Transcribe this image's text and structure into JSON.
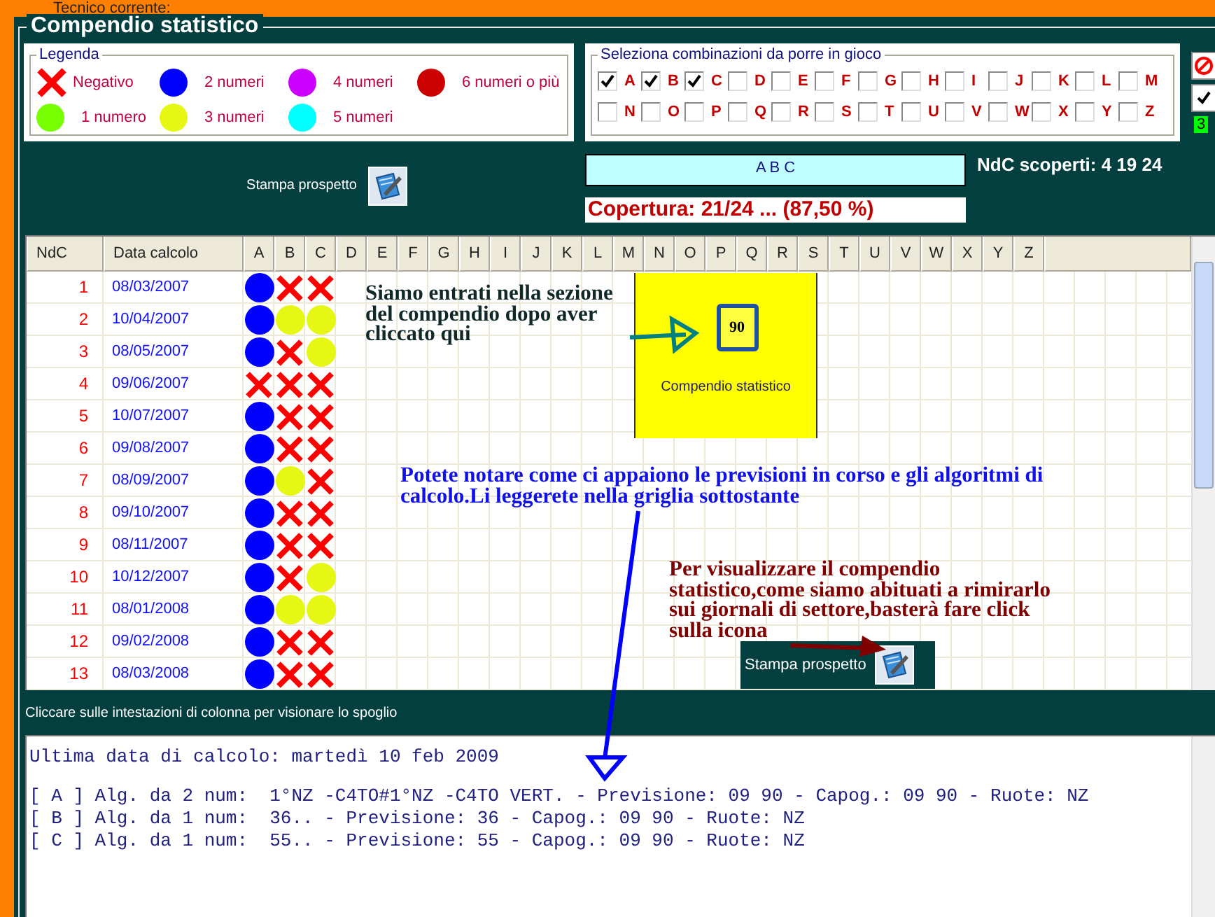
{
  "top_bar": {
    "label": "Tecnico corrente:"
  },
  "panel": {
    "title": "Compendio statistico"
  },
  "legend": {
    "title": "Legenda",
    "items": [
      {
        "kind": "cross",
        "label": "Negativo"
      },
      {
        "kind": "dot",
        "label": "2 numeri",
        "color": "#0000ff"
      },
      {
        "kind": "dot",
        "label": "4 numeri",
        "color": "#cc00ff"
      },
      {
        "kind": "dot",
        "label": "6 numeri o più",
        "color": "#cc0000"
      },
      {
        "kind": "dot",
        "label": "1 numero",
        "color": "#77ff00"
      },
      {
        "kind": "dot",
        "label": "3 numeri",
        "color": "#e6f714"
      },
      {
        "kind": "dot",
        "label": "5 numeri",
        "color": "#00ffff"
      }
    ]
  },
  "selection": {
    "title": "Seleziona combinazioni da porre in gioco",
    "count": "3",
    "options": [
      {
        "label": "A",
        "checked": true
      },
      {
        "label": "B",
        "checked": true
      },
      {
        "label": "C",
        "checked": true
      },
      {
        "label": "D",
        "checked": false
      },
      {
        "label": "E",
        "checked": false
      },
      {
        "label": "F",
        "checked": false
      },
      {
        "label": "G",
        "checked": false
      },
      {
        "label": "H",
        "checked": false
      },
      {
        "label": "I",
        "checked": false
      },
      {
        "label": "J",
        "checked": false
      },
      {
        "label": "K",
        "checked": false
      },
      {
        "label": "L",
        "checked": false
      },
      {
        "label": "M",
        "checked": false
      },
      {
        "label": "N",
        "checked": false
      },
      {
        "label": "O",
        "checked": false
      },
      {
        "label": "P",
        "checked": false
      },
      {
        "label": "Q",
        "checked": false
      },
      {
        "label": "R",
        "checked": false
      },
      {
        "label": "S",
        "checked": false
      },
      {
        "label": "T",
        "checked": false
      },
      {
        "label": "U",
        "checked": false
      },
      {
        "label": "V",
        "checked": false
      },
      {
        "label": "W",
        "checked": false
      },
      {
        "label": "X",
        "checked": false
      },
      {
        "label": "Y",
        "checked": false
      },
      {
        "label": "Z",
        "checked": false
      }
    ]
  },
  "print_button": {
    "label": "Stampa prospetto"
  },
  "selected_combinations": "A B C",
  "uncovered": "NdC scoperti: 4 19 24",
  "coverage": "Copertura: 21/24 ... (87,50 %)",
  "grid": {
    "columns": [
      "NdC",
      "Data calcolo",
      "A",
      "B",
      "C",
      "D",
      "E",
      "F",
      "G",
      "H",
      "I",
      "J",
      "K",
      "L",
      "M",
      "N",
      "O",
      "P",
      "Q",
      "R",
      "S",
      "T",
      "U",
      "V",
      "W",
      "X",
      "Y",
      "Z"
    ],
    "rows": [
      {
        "ndc": "1",
        "date": "08/03/2007",
        "results": [
          {
            "kind": "dot",
            "color": "#0000ff"
          },
          {
            "kind": "cross"
          },
          {
            "kind": "cross"
          }
        ]
      },
      {
        "ndc": "2",
        "date": "10/04/2007",
        "results": [
          {
            "kind": "dot",
            "color": "#0000ff"
          },
          {
            "kind": "dot",
            "color": "#e6f714"
          },
          {
            "kind": "dot",
            "color": "#e6f714"
          }
        ]
      },
      {
        "ndc": "3",
        "date": "08/05/2007",
        "results": [
          {
            "kind": "dot",
            "color": "#0000ff"
          },
          {
            "kind": "cross"
          },
          {
            "kind": "dot",
            "color": "#e6f714"
          }
        ]
      },
      {
        "ndc": "4",
        "date": "09/06/2007",
        "results": [
          {
            "kind": "cross"
          },
          {
            "kind": "cross"
          },
          {
            "kind": "cross"
          }
        ]
      },
      {
        "ndc": "5",
        "date": "10/07/2007",
        "results": [
          {
            "kind": "dot",
            "color": "#0000ff"
          },
          {
            "kind": "cross"
          },
          {
            "kind": "cross"
          }
        ]
      },
      {
        "ndc": "6",
        "date": "09/08/2007",
        "results": [
          {
            "kind": "dot",
            "color": "#0000ff"
          },
          {
            "kind": "cross"
          },
          {
            "kind": "cross"
          }
        ]
      },
      {
        "ndc": "7",
        "date": "08/09/2007",
        "results": [
          {
            "kind": "dot",
            "color": "#0000ff"
          },
          {
            "kind": "dot",
            "color": "#e6f714"
          },
          {
            "kind": "cross"
          }
        ]
      },
      {
        "ndc": "8",
        "date": "09/10/2007",
        "results": [
          {
            "kind": "dot",
            "color": "#0000ff"
          },
          {
            "kind": "cross"
          },
          {
            "kind": "cross"
          }
        ]
      },
      {
        "ndc": "9",
        "date": "08/11/2007",
        "results": [
          {
            "kind": "dot",
            "color": "#0000ff"
          },
          {
            "kind": "cross"
          },
          {
            "kind": "cross"
          }
        ]
      },
      {
        "ndc": "10",
        "date": "10/12/2007",
        "results": [
          {
            "kind": "dot",
            "color": "#0000ff"
          },
          {
            "kind": "cross"
          },
          {
            "kind": "dot",
            "color": "#e6f714"
          }
        ]
      },
      {
        "ndc": "11",
        "date": "08/01/2008",
        "results": [
          {
            "kind": "dot",
            "color": "#0000ff"
          },
          {
            "kind": "dot",
            "color": "#e6f714"
          },
          {
            "kind": "dot",
            "color": "#e6f714"
          }
        ]
      },
      {
        "ndc": "12",
        "date": "09/02/2008",
        "results": [
          {
            "kind": "dot",
            "color": "#0000ff"
          },
          {
            "kind": "cross"
          },
          {
            "kind": "cross"
          }
        ]
      },
      {
        "ndc": "13",
        "date": "08/03/2008",
        "results": [
          {
            "kind": "dot",
            "color": "#0000ff"
          },
          {
            "kind": "cross"
          },
          {
            "kind": "cross"
          }
        ]
      }
    ]
  },
  "annotations": [
    {
      "text": "Siamo entrati nella sezione del compendio dopo aver cliccato qui",
      "color": "#102828"
    },
    {
      "text": "Potete notare come ci appaiono le previsioni in corso e gli algoritmi di calcolo.Li leggerete nella griglia sottostante",
      "color": "#1010e8"
    },
    {
      "text": "Per visualizzare il compendio statistico,come siamo abituati a rimirarlo sui giornali di settore,basterà fare click sulla icona",
      "color": "#800000"
    }
  ],
  "shortcut": {
    "badge": "90",
    "label": "Compendio statistico"
  },
  "floating_print_button": {
    "label": "Stampa prospetto"
  },
  "hint": "Cliccare sulle intestazioni di colonna per visionare lo spoglio",
  "report": {
    "header": "Ultima data di calcolo: martedì 10 feb 2009",
    "lines": [
      "[ A ] Alg. da 2 num:  1°NZ -C4TO#1°NZ -C4TO VERT. - Previsione: 09 90 - Capog.: 09 90 - Ruote: NZ",
      "[ B ] Alg. da 1 num:  36.. - Previsione: 36 - Capog.: 09 90 - Ruote: NZ",
      "[ C ] Alg. da 1 num:  55.. - Previsione: 55 - Capog.: 09 90 - Ruote: NZ"
    ]
  }
}
